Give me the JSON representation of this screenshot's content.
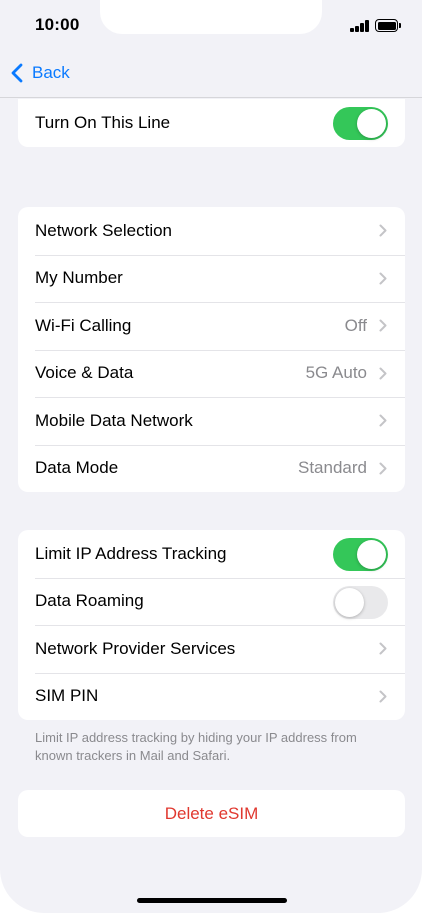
{
  "status_bar": {
    "time": "10:00",
    "icons": [
      "cellular-signal-icon",
      "battery-icon"
    ]
  },
  "nav": {
    "back_label": "Back",
    "back_icon": "chevron-left-icon"
  },
  "colors": {
    "accent": "#0a7aff",
    "toggle_on": "#34c759",
    "destructive": "#e0382f",
    "secondary_text": "#8a8a8e",
    "background": "#f2f2f7"
  },
  "group_top": {
    "turn_on_line": {
      "label": "Turn On This Line",
      "enabled": true
    }
  },
  "group_network": {
    "network_selection": {
      "label": "Network Selection"
    },
    "my_number": {
      "label": "My Number"
    },
    "wifi_calling": {
      "label": "Wi-Fi Calling",
      "value": "Off"
    },
    "voice_data": {
      "label": "Voice & Data",
      "value": "5G Auto"
    },
    "mobile_data_network": {
      "label": "Mobile Data Network"
    },
    "data_mode": {
      "label": "Data Mode",
      "value": "Standard"
    }
  },
  "group_privacy": {
    "limit_ip": {
      "label": "Limit IP Address Tracking",
      "enabled": true
    },
    "data_roaming": {
      "label": "Data Roaming",
      "enabled": false
    },
    "provider_services": {
      "label": "Network Provider Services"
    },
    "sim_pin": {
      "label": "SIM PIN"
    },
    "footer": "Limit IP address tracking by hiding your IP address from known trackers in Mail and Safari."
  },
  "delete": {
    "label": "Delete eSIM"
  }
}
